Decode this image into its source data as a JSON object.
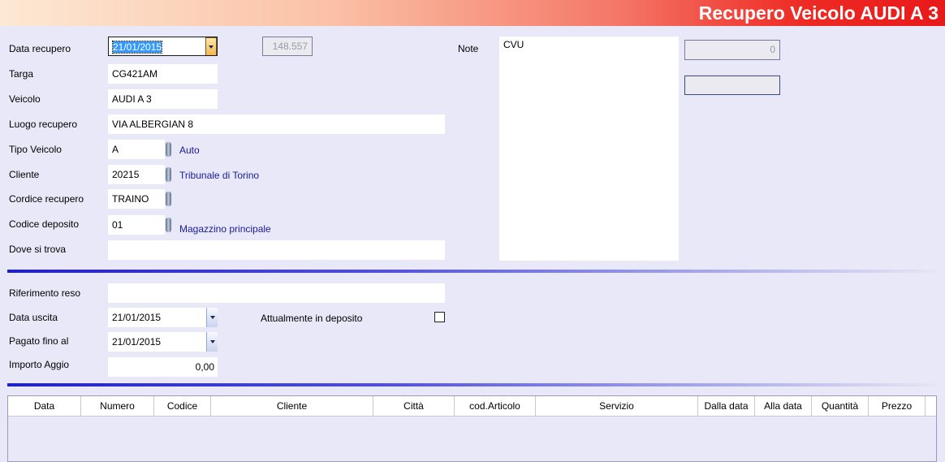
{
  "header": {
    "title": "Recupero Veicolo AUDI A 3"
  },
  "form": {
    "data_recupero": {
      "label": "Data recupero",
      "value": "21/01/2015"
    },
    "number_box": "148.557",
    "targa": {
      "label": "Targa",
      "value": "CG421AM"
    },
    "veicolo": {
      "label": "Veicolo",
      "value": "AUDI A 3"
    },
    "luogo_recupero": {
      "label": "Luogo recupero",
      "value": "VIA ALBERGIAN 8"
    },
    "tipo_veicolo": {
      "label": "Tipo Veicolo",
      "value": "A",
      "desc": "Auto"
    },
    "cliente": {
      "label": "Cliente",
      "value": "20215",
      "desc": "Tribunale di Torino"
    },
    "codice_recupero": {
      "label": "Cordice recupero",
      "value": "TRAINO"
    },
    "codice_deposito": {
      "label": "Codice deposito",
      "value": "01",
      "desc": "Magazzino principale"
    },
    "dove_si_trova": {
      "label": "Dove si trova",
      "value": ""
    },
    "note": {
      "label": "Note",
      "value": "CVU"
    },
    "counter_box": "0",
    "empty_box": ""
  },
  "section2": {
    "riferimento_reso": {
      "label": "Riferimento reso",
      "value": ""
    },
    "data_uscita": {
      "label": "Data uscita",
      "value": "21/01/2015"
    },
    "attualmente_in_deposito": {
      "label": "Attualmente in deposito",
      "checked": false
    },
    "pagato_fino_al": {
      "label": "Pagato fino al",
      "value": "21/01/2015"
    },
    "importo_aggio": {
      "label": "Importo Aggio",
      "value": "0,00"
    }
  },
  "table": {
    "columns": [
      "Data",
      "Numero",
      "Codice",
      "Cliente",
      "Città",
      "cod.Articolo",
      "Servizio",
      "Dalla data",
      "Alla data",
      "Quantità",
      "Prezzo"
    ],
    "rows": []
  },
  "colors": {
    "accent_red": "#e81919",
    "background": "#e8e8f8",
    "link_blue": "#1a1a9a"
  }
}
